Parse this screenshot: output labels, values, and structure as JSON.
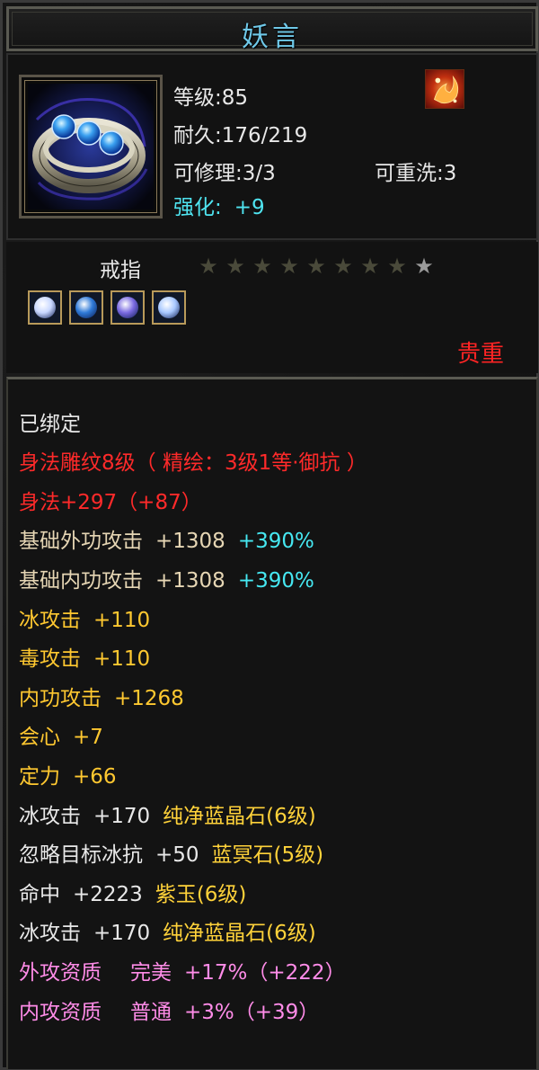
{
  "title": "妖言",
  "item": {
    "level_label": "等级",
    "level_value": ":85",
    "durability_label": "耐久",
    "durability_value": ":176/219",
    "repair_label": "可修理",
    "repair_value": ":3/3",
    "rewash_label": "可重洗",
    "rewash_value": ":3",
    "enhance_label": "强化:",
    "enhance_value": "+9",
    "type": "戒指",
    "stars_filled": 8,
    "stars_total": 9,
    "rarity": "贵重",
    "icon": "ring-with-blue-gems-icon",
    "special_icon": "fire-phoenix-icon"
  },
  "gems": [
    {
      "icon": "gem-socket-icon",
      "color": "#c9d8ff"
    },
    {
      "icon": "gem-socket-icon",
      "color": "#2f7ad8"
    },
    {
      "icon": "gem-socket-icon",
      "color": "#7a6ae0"
    },
    {
      "icon": "gem-socket-icon",
      "color": "#a8c8ff"
    }
  ],
  "attributes": {
    "bound": "已绑定",
    "engraving": "身法雕纹8级（ 精绘：3级1等·御抗 ）",
    "agility": "身法+297（+87）",
    "ext_atk_name": "基础外功攻击",
    "ext_atk_val": "+1308",
    "ext_atk_pct": "+390%",
    "int_atk_name": "基础内功攻击",
    "int_atk_val": "+1308",
    "int_atk_pct": "+390%",
    "ice_atk_name": "冰攻击",
    "ice_atk_val": "+110",
    "poison_atk_name": "毒攻击",
    "poison_atk_val": "+110",
    "inner_atk_name": "内功攻击",
    "inner_atk_val": "+1268",
    "crit_name": "会心",
    "crit_val": "+7",
    "focus_name": "定力",
    "focus_val": "+66",
    "gem1_stat": "冰攻击",
    "gem1_val": "+170",
    "gem1_name": "纯净蓝晶石(6级)",
    "gem2_stat": "忽略目标冰抗",
    "gem2_val": "+50",
    "gem2_name": "蓝冥石(5级)",
    "gem3_stat": "命中",
    "gem3_val": "+2223",
    "gem3_name": "紫玉(6级)",
    "gem4_stat": "冰攻击",
    "gem4_val": "+170",
    "gem4_name": "纯净蓝晶石(6级)",
    "apt1_name": "外攻资质",
    "apt1_grade": "完美",
    "apt1_val": "+17%（+222）",
    "apt2_name": "内攻资质",
    "apt2_grade": "普通",
    "apt2_val": "+3%（+39）"
  }
}
